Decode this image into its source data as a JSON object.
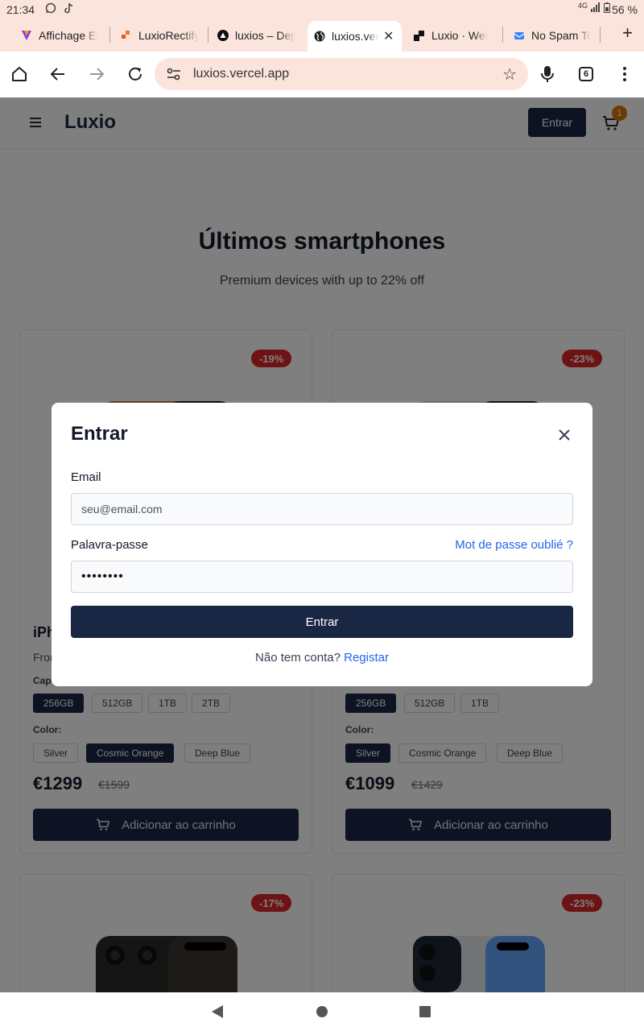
{
  "status_bar": {
    "time": "21:34",
    "battery": "56 %",
    "network": "4G"
  },
  "tabs": [
    {
      "title": "Affichage Er"
    },
    {
      "title": "LuxioRectify"
    },
    {
      "title": "luxios – Dep"
    },
    {
      "title": "luxios.ver",
      "active": true
    },
    {
      "title": "Luxio · Wel"
    },
    {
      "title": "No Spam To"
    }
  ],
  "toolbar": {
    "url": "luxios.vercel.app",
    "tab_count": "6"
  },
  "site": {
    "brand": "Luxio",
    "login_button": "Entrar",
    "cart_count": "1",
    "hero_title": "Últimos smartphones",
    "hero_subtitle": "Premium devices with up to 22% off"
  },
  "products": [
    {
      "discount": "-19%",
      "title_visible": "iPh",
      "from_visible": "From",
      "capacity_label": "Cap",
      "capacities": [
        "256GB",
        "512GB",
        "1TB",
        "2TB"
      ],
      "selected_capacity": "256GB",
      "color_label": "Color:",
      "colors": [
        "Silver",
        "Cosmic Orange",
        "Deep Blue"
      ],
      "selected_color": "Cosmic Orange",
      "price": "€1299",
      "old_price": "€1599",
      "add_to_cart": "Adicionar ao carrinho"
    },
    {
      "discount": "-23%",
      "capacities": [
        "256GB",
        "512GB",
        "1TB"
      ],
      "selected_capacity": "256GB",
      "color_label": "Color:",
      "colors": [
        "Silver",
        "Cosmic Orange",
        "Deep Blue"
      ],
      "selected_color": "Silver",
      "price": "€1099",
      "old_price": "€1429",
      "add_to_cart": "Adicionar ao carrinho"
    },
    {
      "discount": "-17%"
    },
    {
      "discount": "-23%"
    }
  ],
  "login_modal": {
    "title": "Entrar",
    "email_label": "Email",
    "email_placeholder": "seu@email.com",
    "password_label": "Palavra-passe",
    "password_value": "••••••••",
    "forgot_password": "Mot de passe oublié ?",
    "submit": "Entrar",
    "no_account": "Não tem conta?",
    "register": "Registar"
  },
  "colors": {
    "navy": "#1a2744",
    "discount_red": "#dc2626",
    "link_blue": "#2563eb",
    "cart_badge": "#d97706",
    "browser_chrome": "#fbe4dc"
  }
}
